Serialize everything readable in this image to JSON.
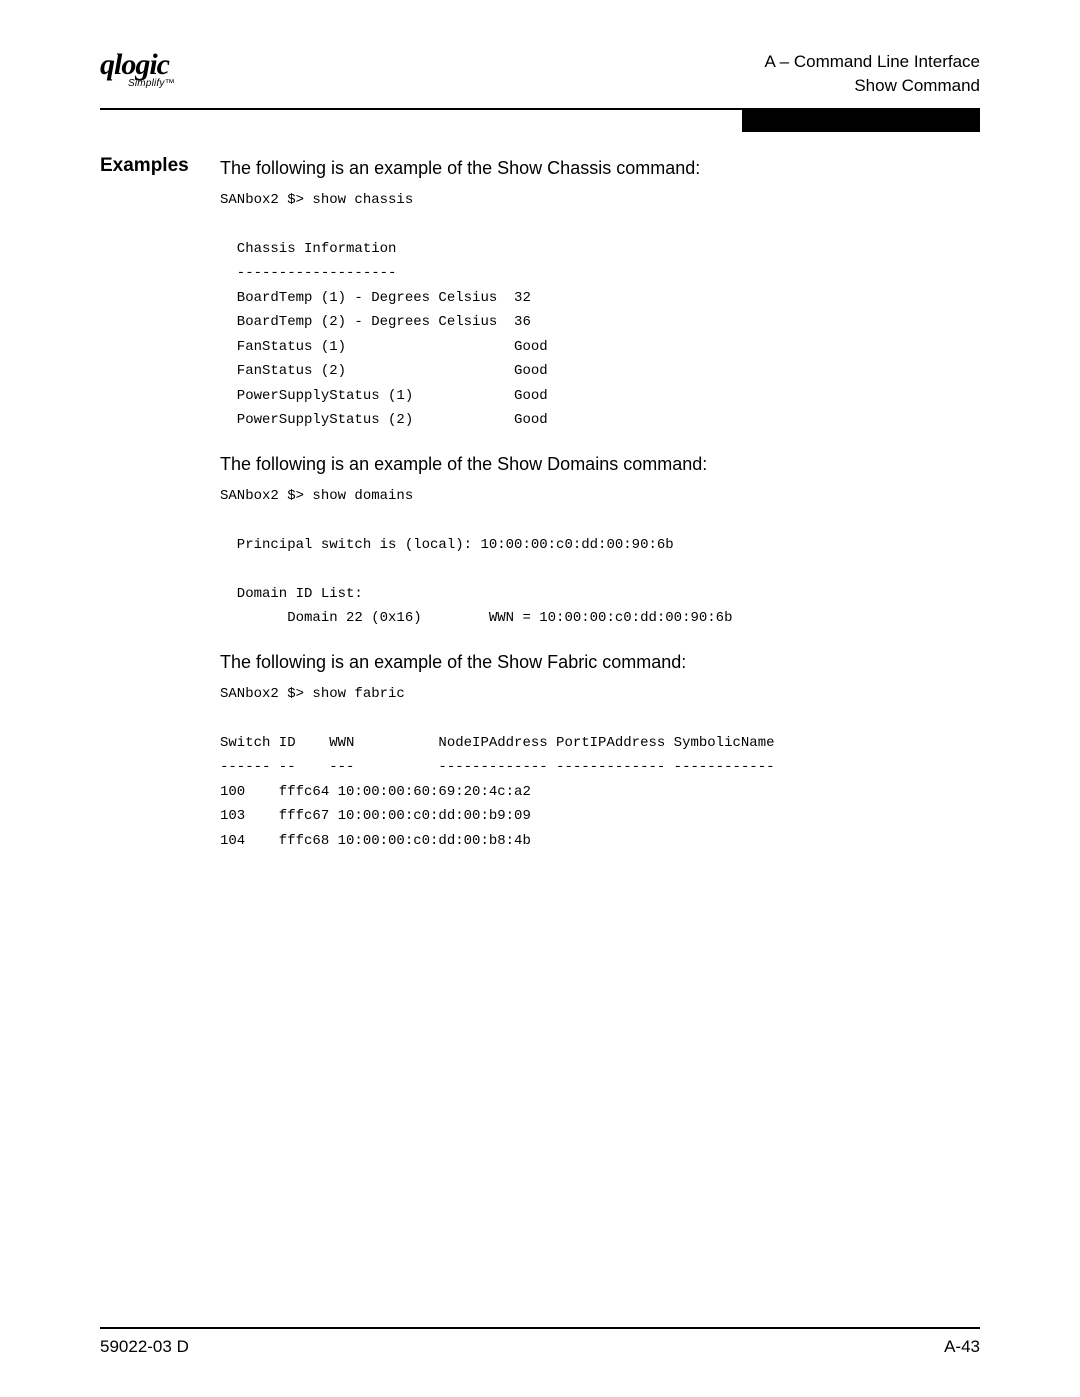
{
  "header": {
    "logo_top": "qlogic",
    "logo_sub": "Simplify™",
    "line1": "A – Command Line Interface",
    "line2": "Show Command"
  },
  "section_label": "Examples",
  "example1_intro": "The following is an example of the Show Chassis command:",
  "example1_code": "SANbox2 $> show chassis\n\n  Chassis Information\n  -------------------\n  BoardTemp (1) - Degrees Celsius  32\n  BoardTemp (2) - Degrees Celsius  36\n  FanStatus (1)                    Good\n  FanStatus (2)                    Good\n  PowerSupplyStatus (1)            Good\n  PowerSupplyStatus (2)            Good",
  "example2_intro": "The following is an example of the Show Domains command:",
  "example2_code": "SANbox2 $> show domains\n\n  Principal switch is (local): 10:00:00:c0:dd:00:90:6b\n\n  Domain ID List:\n        Domain 22 (0x16)        WWN = 10:00:00:c0:dd:00:90:6b\n",
  "example3_intro": "The following is an example of the Show Fabric command:",
  "example3_code": "SANbox2 $> show fabric\n\nSwitch ID    WWN          NodeIPAddress PortIPAddress SymbolicName\n------ --    ---          ------------- ------------- ------------\n100    fffc64 10:00:00:60:69:20:4c:a2\n103    fffc67 10:00:00:c0:dd:00:b9:09\n104    fffc68 10:00:00:c0:dd:00:b8:4b",
  "footer": {
    "left": "59022-03 D",
    "right": "A-43"
  }
}
